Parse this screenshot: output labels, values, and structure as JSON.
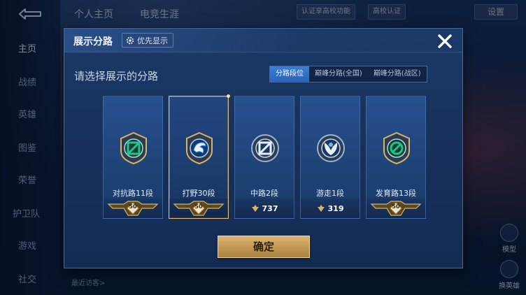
{
  "top": {
    "tabs": [
      "个人主页",
      "电竞生涯"
    ],
    "pills": [
      "认证享高校功能",
      "高校认证"
    ],
    "settings_label": "设置"
  },
  "sidebar": {
    "items": [
      {
        "label": "主页",
        "active": true
      },
      {
        "label": "战绩",
        "active": false
      },
      {
        "label": "英雄",
        "active": false
      },
      {
        "label": "图鉴",
        "active": false
      },
      {
        "label": "荣誉",
        "active": false
      },
      {
        "label": "护卫队",
        "active": false
      },
      {
        "label": "游戏",
        "active": false
      },
      {
        "label": "社交",
        "active": false
      }
    ]
  },
  "right": {
    "model_label": "模型",
    "change_hero_label": "换英雄"
  },
  "bottom": {
    "recent_label": "最近访客>"
  },
  "modal": {
    "title": "展示分路",
    "priority_label": "优先显示",
    "subtitle": "请选择展示的分路",
    "segments": [
      {
        "label": "分路段位",
        "active": true
      },
      {
        "label": "巅峰分路(全国)",
        "active": false
      },
      {
        "label": "巅峰分路(战区)",
        "active": false
      }
    ],
    "cards": [
      {
        "label": "对抗路11段",
        "footer_type": "level",
        "footer_value": "50",
        "icon": "clash-lane-icon",
        "accent": "#22c48a",
        "selected": false
      },
      {
        "label": "打野30段",
        "footer_type": "level",
        "footer_value": "50",
        "icon": "jungle-dragon-icon",
        "accent": "#2f7fe0",
        "selected": true
      },
      {
        "label": "中路2段",
        "footer_type": "points",
        "footer_value": "737",
        "icon": "mid-lane-icon",
        "accent": "#4a8fd8",
        "selected": false
      },
      {
        "label": "游走1段",
        "footer_type": "points",
        "footer_value": "319",
        "icon": "roam-wings-icon",
        "accent": "#7fb0e6",
        "selected": false
      },
      {
        "label": "发育路13段",
        "footer_type": "level",
        "footer_value": "50",
        "icon": "farm-lane-icon",
        "accent": "#22c48a",
        "selected": false
      }
    ],
    "confirm_label": "确定"
  },
  "colors": {
    "gold": "#e2c07c",
    "accent_blue": "#3a7fd8",
    "panel": "#1c3a68"
  }
}
